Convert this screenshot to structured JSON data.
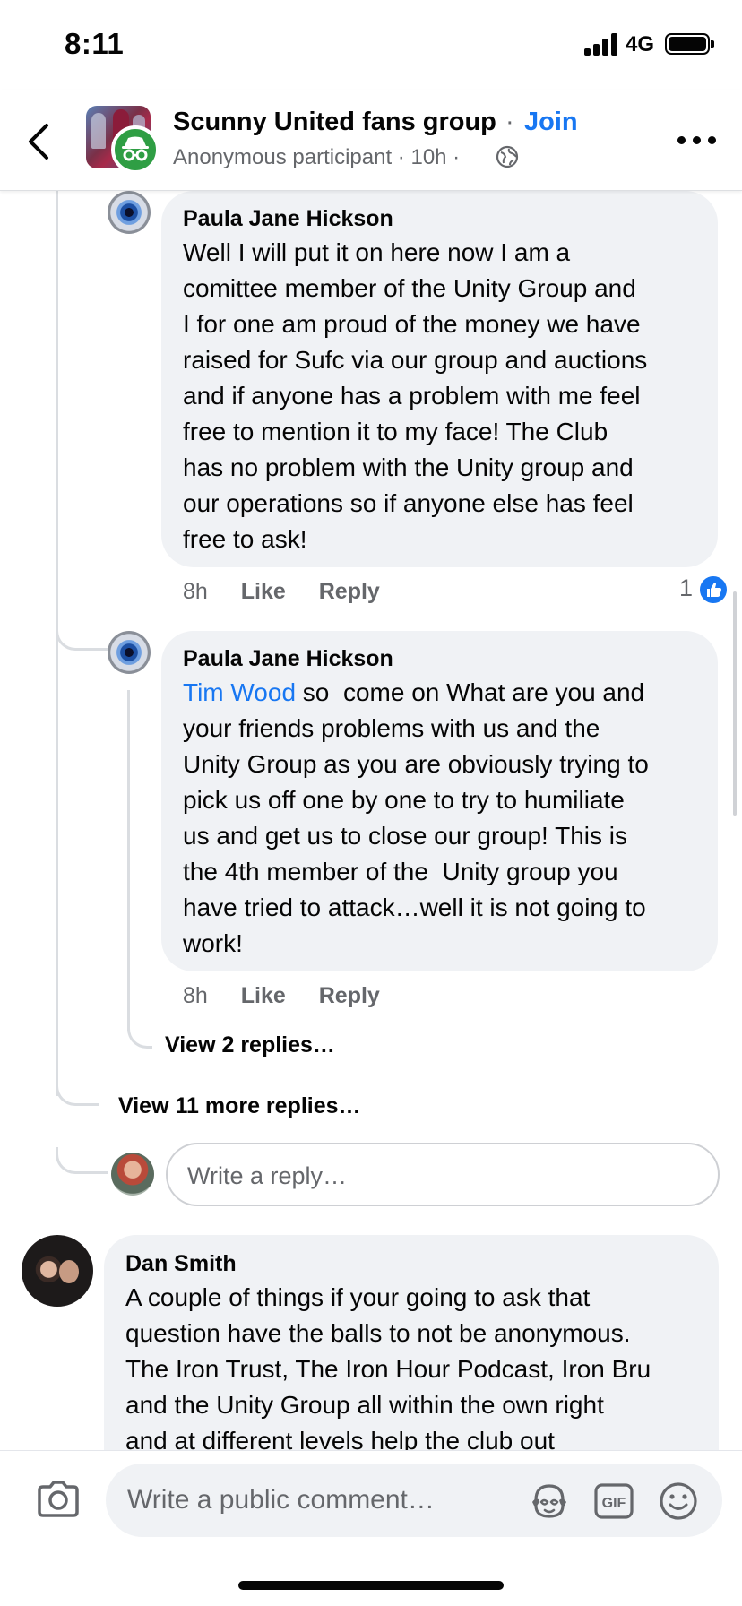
{
  "status_bar": {
    "time": "8:11",
    "network": "4G"
  },
  "header": {
    "group_name": "Scunny United fans group",
    "separator": "·",
    "join_label": "Join",
    "meta": "Anonymous participant · 10h ·",
    "icons": [
      "back-arrow-icon",
      "anonymous-icon",
      "globe-icon",
      "more-icon"
    ]
  },
  "comments": [
    {
      "author": "Paula Jane Hickson",
      "text_lines": [
        "Well I will put it on here now I am a",
        "comittee member of the Unity Group and",
        "I for one am proud of the money we have",
        "raised for Sufc via our group and auctions",
        "and if anyone has a problem with me feel",
        "free to mention it to my face! The Club",
        "has no problem with the Unity group and",
        "our operations so if anyone else has feel",
        "free to ask!"
      ],
      "time": "8h",
      "like_label": "Like",
      "reply_label": "Reply",
      "reaction_count": "1"
    },
    {
      "author": "Paula Jane Hickson",
      "mention": "Tim Wood",
      "first_line_rest": " so  come on What are you and",
      "text_lines": [
        "your friends problems with us and the",
        "Unity Group as you are obviously trying to",
        "pick us off one by one to try to humiliate",
        "us and get us to close our group! This is",
        "the 4th member of the  Unity group you",
        "have tried to attack…well it is not going to",
        "work!"
      ],
      "time": "8h",
      "like_label": "Like",
      "reply_label": "Reply",
      "view_replies": "View 2 replies…"
    }
  ],
  "view_more_replies": "View 11 more replies…",
  "reply_placeholder": "Write a reply…",
  "dan_comment": {
    "author": "Dan Smith",
    "text_lines": [
      "A couple of things if your going to ask that",
      "question have the balls to not be anonymous.",
      "The Iron Trust, The Iron Hour Podcast, Iron Bru",
      "and the Unity Group all within the own right",
      "and at different levels help the club out"
    ]
  },
  "bottom_bar": {
    "placeholder": "Write a public comment…",
    "icons": [
      "camera-icon",
      "avatar-sticker-icon",
      "gif-icon",
      "emoji-icon"
    ],
    "gif_label": "GIF"
  },
  "colors": {
    "accent": "#1877f2",
    "anonymous_badge": "#2f9e44",
    "bubble": "#f0f2f5",
    "secondary_text": "#65676b"
  }
}
